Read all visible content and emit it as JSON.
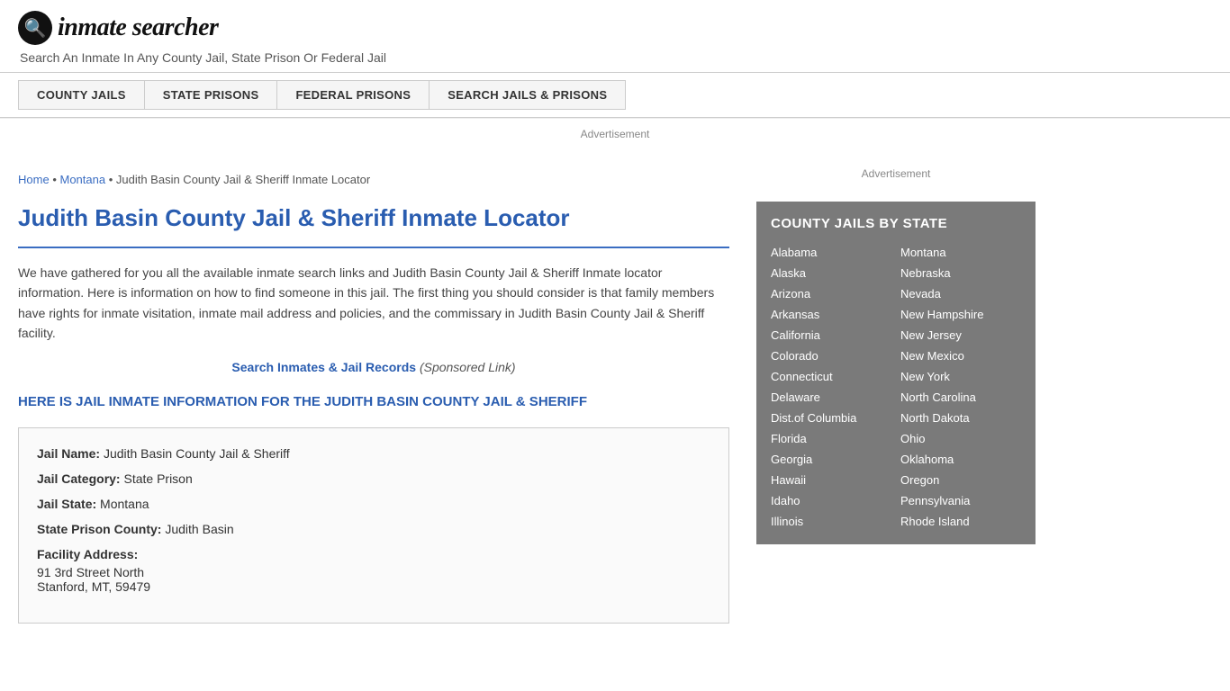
{
  "header": {
    "logo_icon": "🔍",
    "logo_text_prefix": "inmate",
    "logo_text_suffix": "searcher",
    "tagline": "Search An Inmate In Any County Jail, State Prison Or Federal Jail"
  },
  "nav": {
    "items": [
      {
        "id": "county-jails",
        "label": "COUNTY JAILS"
      },
      {
        "id": "state-prisons",
        "label": "STATE PRISONS"
      },
      {
        "id": "federal-prisons",
        "label": "FEDERAL PRISONS"
      },
      {
        "id": "search-jails",
        "label": "SEARCH JAILS & PRISONS"
      }
    ]
  },
  "ad": {
    "banner_label": "Advertisement"
  },
  "breadcrumb": {
    "home": "Home",
    "state": "Montana",
    "current": "Judith Basin County Jail & Sheriff Inmate Locator"
  },
  "page": {
    "title": "Judith Basin County Jail & Sheriff Inmate Locator",
    "description": "We have gathered for you all the available inmate search links and Judith Basin County Jail & Sheriff Inmate locator information. Here is information on how to find someone in this jail. The first thing you should consider is that family members have rights for inmate visitation, inmate mail address and policies, and the commissary in Judith Basin County Jail & Sheriff facility.",
    "search_link_text": "Search Inmates & Jail Records",
    "search_link_sponsored": "(Sponsored Link)",
    "jail_section_heading": "HERE IS JAIL INMATE INFORMATION FOR THE JUDITH BASIN COUNTY JAIL & SHERIFF"
  },
  "jail_info": {
    "name_label": "Jail Name:",
    "name_value": "Judith Basin County Jail & Sheriff",
    "category_label": "Jail Category:",
    "category_value": "State Prison",
    "state_label": "Jail State:",
    "state_value": "Montana",
    "county_label": "State Prison County:",
    "county_value": "Judith Basin",
    "address_label": "Facility Address:",
    "address_line1": "91 3rd Street North",
    "address_line2": "Stanford, MT, 59479"
  },
  "sidebar": {
    "ad_label": "Advertisement",
    "county_jails_title": "COUNTY JAILS BY STATE",
    "states_col1": [
      "Alabama",
      "Alaska",
      "Arizona",
      "Arkansas",
      "California",
      "Colorado",
      "Connecticut",
      "Delaware",
      "Dist.of Columbia",
      "Florida",
      "Georgia",
      "Hawaii",
      "Idaho",
      "Illinois"
    ],
    "states_col2": [
      "Montana",
      "Nebraska",
      "Nevada",
      "New Hampshire",
      "New Jersey",
      "New Mexico",
      "New York",
      "North Carolina",
      "North Dakota",
      "Ohio",
      "Oklahoma",
      "Oregon",
      "Pennsylvania",
      "Rhode Island"
    ]
  }
}
